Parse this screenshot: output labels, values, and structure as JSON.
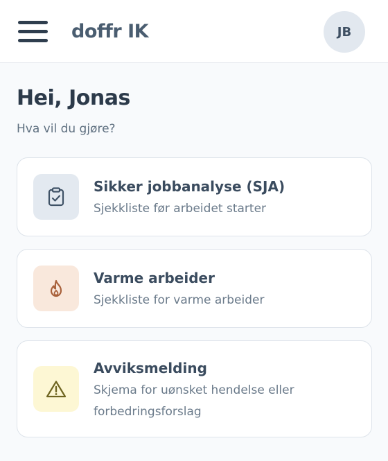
{
  "header": {
    "brand": "doffr IK",
    "avatar_initials": "JB",
    "menu_icon": "hamburger-menu-icon"
  },
  "main": {
    "greeting": "Hei, Jonas",
    "subtitle": "Hva vil du gjøre?"
  },
  "cards": [
    {
      "title": "Sikker jobbanalyse (SJA)",
      "description": "Sjekkliste før arbeidet starter",
      "icon": "clipboard-check-icon",
      "icon_bg": "#e3e9f0",
      "icon_color": "#3f5266"
    },
    {
      "title": "Varme arbeider",
      "description": "Sjekkliste for varme arbeider",
      "icon": "flame-icon",
      "icon_bg": "#f9e8dc",
      "icon_color": "#a8603a"
    },
    {
      "title": "Avviksmelding",
      "description": "Skjema for uønsket hendelse eller forbedringsforslag",
      "icon": "warning-triangle-icon",
      "icon_bg": "#fdf7d4",
      "icon_color": "#6e6420"
    }
  ]
}
